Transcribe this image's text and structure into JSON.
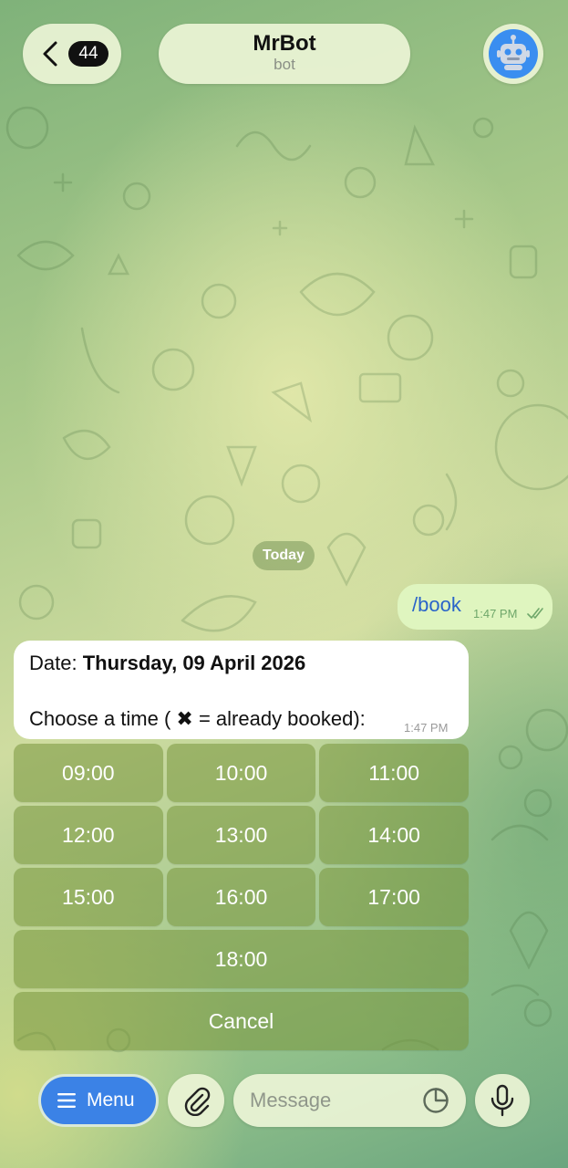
{
  "header": {
    "back_count": "44",
    "title": "MrBot",
    "subtitle": "bot"
  },
  "chat": {
    "date_chip": "Today",
    "outgoing": {
      "text": "/book",
      "time": "1:47 PM",
      "status": "read"
    },
    "incoming": {
      "date_label": "Date: ",
      "date_value": "Thursday, 09 April 2026",
      "prompt_before": "Choose a time ( ",
      "prompt_icon": "✖",
      "prompt_after": " = already booked):",
      "time": "1:47 PM"
    }
  },
  "keyboard": {
    "rows": [
      [
        "09:00",
        "10:00",
        "11:00"
      ],
      [
        "12:00",
        "13:00",
        "14:00"
      ],
      [
        "15:00",
        "16:00",
        "17:00"
      ],
      [
        "18:00"
      ],
      [
        "Cancel"
      ]
    ]
  },
  "composer": {
    "menu_label": "Menu",
    "placeholder": "Message"
  },
  "colors": {
    "accent": "#3b82e6",
    "outgoing_bubble": "#dff5bf",
    "link_text": "#2a64c9",
    "read_check": "#6fa76a"
  },
  "icons": {
    "back": "chevron-left-icon",
    "avatar": "robot-icon",
    "menu": "hamburger-icon",
    "attach": "paperclip-icon",
    "sticker": "sticker-icon",
    "mic": "microphone-icon",
    "read": "double-check-icon"
  }
}
